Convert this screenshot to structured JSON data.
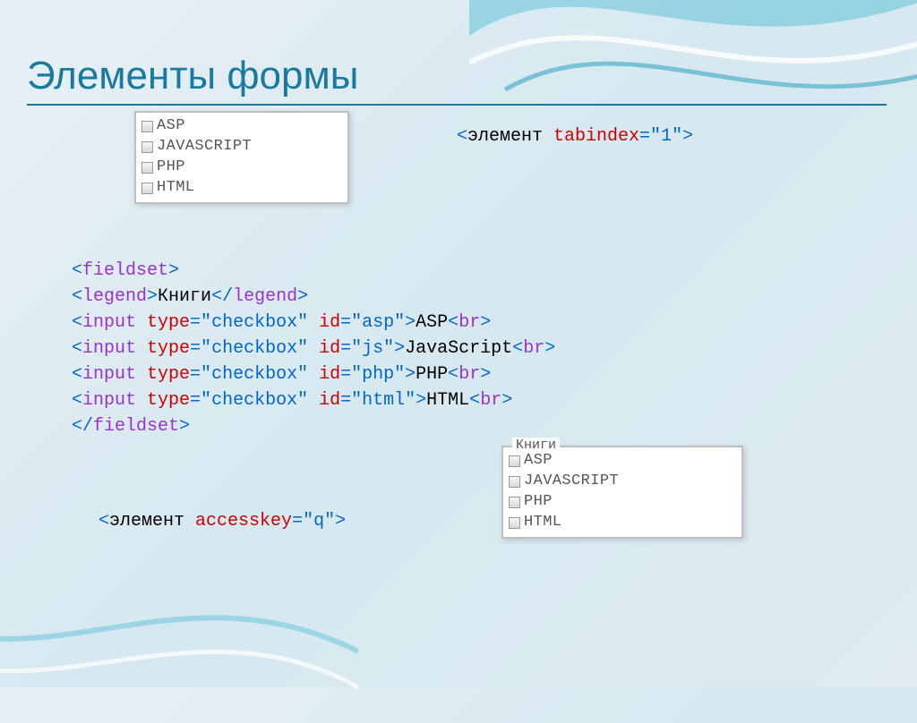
{
  "title": "Элементы формы",
  "listbox1": {
    "items": [
      "ASP",
      "JavaScript",
      "PHP",
      "HTML"
    ]
  },
  "listbox2": {
    "legend": "Книги",
    "items": [
      "ASP",
      "JavaScript",
      "PHP",
      "HTML"
    ]
  },
  "code_tabindex": {
    "open": "<",
    "element": "элемент ",
    "attr": "tabindex",
    "eq": "=\"",
    "val": "1",
    "close": "\">"
  },
  "code_fieldset": {
    "l1_open": "<",
    "l1_tag": "fieldset",
    "l1_close": ">",
    "l2_open": "<",
    "l2_tag": "legend",
    "l2_close": ">",
    "l2_text": "Книги",
    "l2_endopen": "</",
    "l2_endtag": "legend",
    "l2_endclose": ">",
    "input_open": "<",
    "input_tag": "input ",
    "input_typeattr": "type",
    "input_typeeq": "=\"",
    "input_typeval": "checkbox",
    "input_typeclose": "\" ",
    "input_idattr": "id",
    "input_ideq": "=\"",
    "rows": [
      {
        "id": "asp",
        "label": "ASP"
      },
      {
        "id": "js",
        "label": "JavaScript"
      },
      {
        "id": "php",
        "label": "PHP"
      },
      {
        "id": "html",
        "label": "HTML"
      }
    ],
    "input_idclose": "\">",
    "br_open": "<",
    "br_tag": "br",
    "br_close": ">",
    "l7_open": "</",
    "l7_tag": "fieldset",
    "l7_close": ">"
  },
  "code_accesskey": {
    "open": "<",
    "element": "элемент ",
    "attr": "accesskey",
    "eq": "=\"",
    "val": "q",
    "close": "\">"
  }
}
